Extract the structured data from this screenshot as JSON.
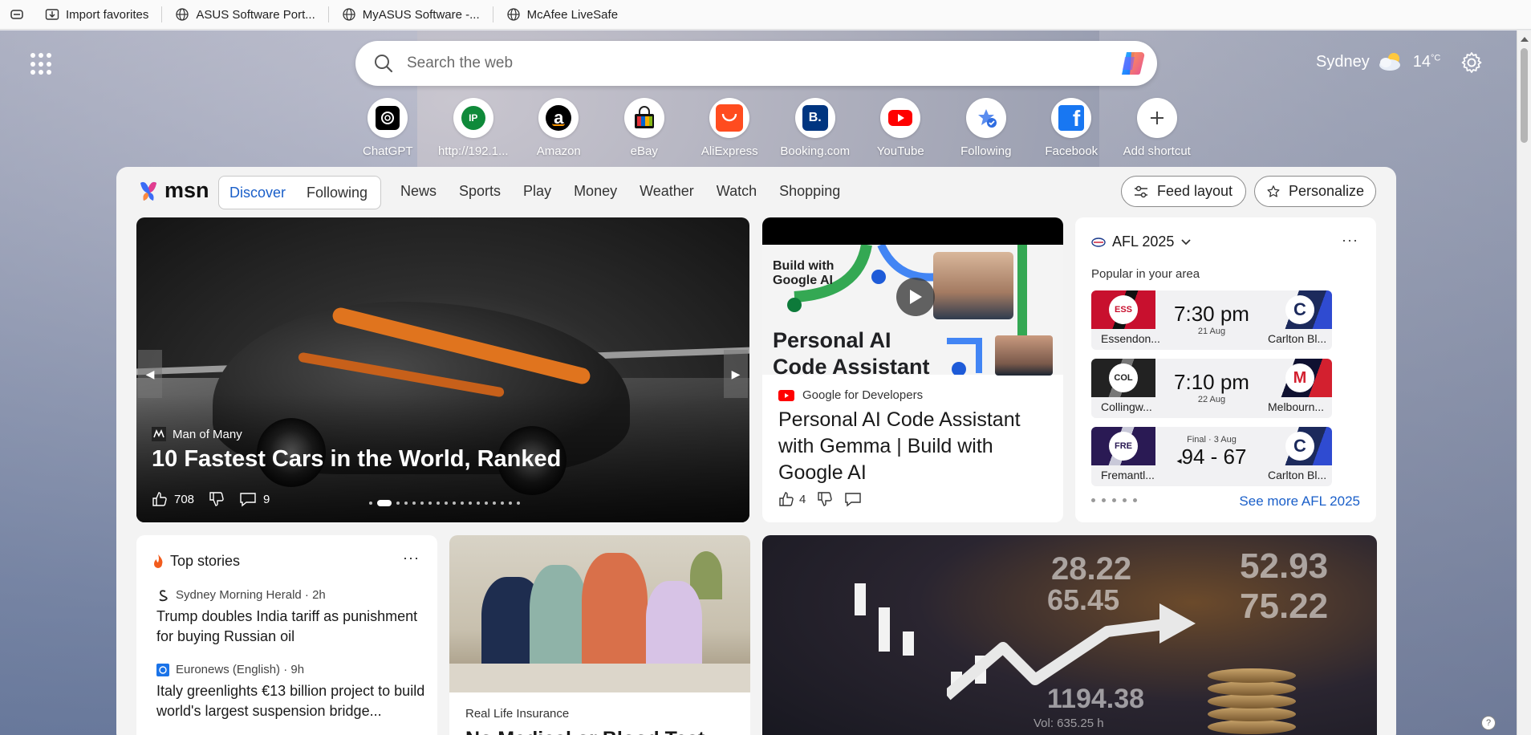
{
  "favorites": [
    {
      "label": "Import favorites",
      "icon": "folder-import-icon"
    },
    {
      "label": "ASUS Software Port...",
      "icon": "globe-icon"
    },
    {
      "label": "MyASUS Software -...",
      "icon": "globe-icon"
    },
    {
      "label": "McAfee LiveSafe",
      "icon": "globe-icon"
    }
  ],
  "search": {
    "placeholder": "Search the web"
  },
  "weather": {
    "city": "Sydney",
    "temp": "14",
    "unit": "°C",
    "icon": "partly-cloudy-icon"
  },
  "shortcuts": [
    {
      "label": "ChatGPT",
      "icon": "chatgpt-icon"
    },
    {
      "label": "http://192.1...",
      "icon": "ip-icon",
      "badge": "IP"
    },
    {
      "label": "Amazon",
      "icon": "amazon-icon"
    },
    {
      "label": "eBay",
      "icon": "ebay-icon"
    },
    {
      "label": "AliExpress",
      "icon": "aliexpress-icon"
    },
    {
      "label": "Booking.com",
      "icon": "booking-icon",
      "badge": "B."
    },
    {
      "label": "YouTube",
      "icon": "youtube-icon"
    },
    {
      "label": "Following",
      "icon": "following-icon"
    },
    {
      "label": "Facebook",
      "icon": "facebook-icon"
    },
    {
      "label": "Add shortcut",
      "icon": "plus-icon"
    }
  ],
  "nav": {
    "brand": "msn",
    "segments": [
      "Discover",
      "Following"
    ],
    "active_segment": "Discover",
    "items": [
      "News",
      "Sports",
      "Play",
      "Money",
      "Weather",
      "Watch",
      "Shopping"
    ],
    "feed_layout": "Feed layout",
    "personalize": "Personalize"
  },
  "hero": {
    "source": "Man of Many",
    "title": "10 Fastest Cars in the World, Ranked",
    "likes": "708",
    "comments": "9"
  },
  "video": {
    "thumb_line1": "Build with",
    "thumb_line2": "Google AI",
    "thumb_title1": "Personal AI",
    "thumb_title2": "Code Assistant",
    "source": "Google for Developers",
    "title": "Personal AI Code Assistant with Gemma | Build with Google AI",
    "likes": "4"
  },
  "afl": {
    "title": "AFL 2025",
    "subtitle": "Popular in your area",
    "matches": [
      {
        "home": "Essendon...",
        "away": "Carlton Bl...",
        "main": "7:30 pm",
        "sub": "21 Aug",
        "home_color": "#c8102e",
        "away_color": "#1c2a5c",
        "home_crest": "ESS",
        "away_crest": "C"
      },
      {
        "home": "Collingw...",
        "away": "Melbourn...",
        "main": "7:10 pm",
        "sub": "22 Aug",
        "home_color": "#222222",
        "away_color": "#0f1131",
        "home_crest": "COL",
        "away_crest": "M"
      },
      {
        "home": "Fremantl...",
        "away": "Carlton Bl...",
        "main": "94 - 67",
        "sub": "Final · 3 Aug",
        "home_color": "#2a1a54",
        "away_color": "#1c2a5c",
        "home_crest": "FRE",
        "away_crest": "C"
      }
    ],
    "link": "See more AFL 2025"
  },
  "top_stories": {
    "title": "Top stories",
    "items": [
      {
        "source": "Sydney Morning Herald · 2h",
        "title": "Trump doubles India tariff as punishment for buying Russian oil"
      },
      {
        "source": "Euronews (English) · 9h",
        "title": "Italy greenlights €13 billion project to build world's largest suspension bridge..."
      }
    ]
  },
  "family_card": {
    "source": "Real Life Insurance",
    "title": "No Medical or Blood Test"
  },
  "finance_card": {
    "numbers": [
      "28.22",
      "52.93",
      "65.45",
      "75.22",
      "1194.38",
      "Vol: 635.25 h"
    ]
  },
  "colors": {
    "accent": "#1a5fc9",
    "youtube": "#ff0000",
    "facebook": "#1877f2",
    "aliexpress": "#ff4c1f"
  }
}
